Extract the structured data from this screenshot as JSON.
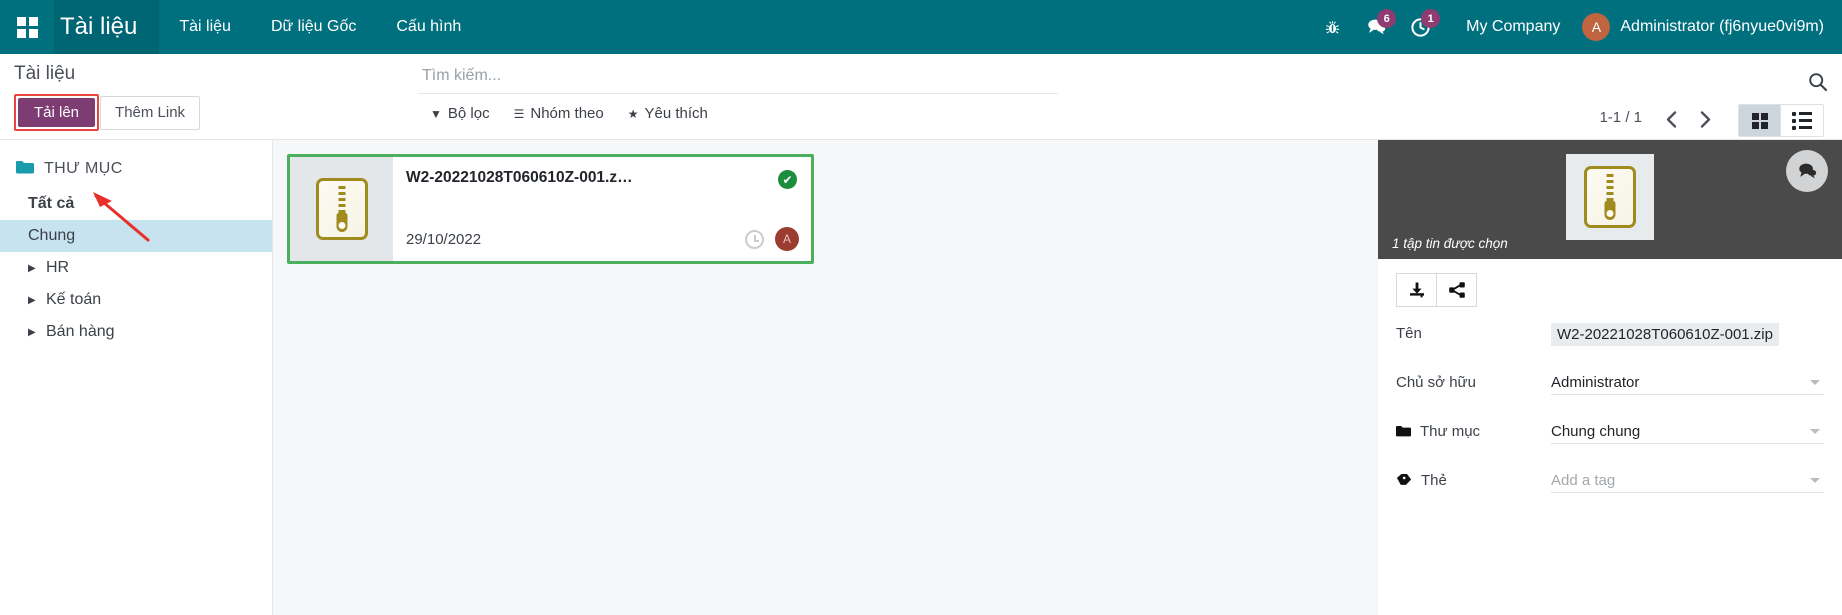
{
  "navbar": {
    "brand": "Tài liệu",
    "apps_icon": "apps-grid-icon",
    "menu": [
      {
        "label": "Tài liệu"
      },
      {
        "label": "Dữ liệu Gốc"
      },
      {
        "label": "Cấu hình"
      }
    ],
    "bug_icon": "bug-icon",
    "messages_icon": "chat-icon",
    "messages_count": "6",
    "activities_icon": "clock-activity-icon",
    "activities_count": "1",
    "company": "My Company",
    "user_initial": "A",
    "user": "Administrator (fj6nyue0vi9m)",
    "accent": "#00707f",
    "badge_color": "#8f3c72"
  },
  "control_panel": {
    "title": "Tài liệu",
    "upload_button": "Tải lên",
    "add_link_button": "Thêm Link",
    "upload_highlight_color": "#e8453c",
    "upload_button_color": "#7d3c72"
  },
  "search": {
    "placeholder": "Tìm kiếm...",
    "search_icon": "search-icon",
    "filters": [
      {
        "label": "Bộ lọc",
        "icon": "filter-icon"
      },
      {
        "label": "Nhóm theo",
        "icon": "group-by-icon"
      },
      {
        "label": "Yêu thích",
        "icon": "star-icon"
      }
    ]
  },
  "pager": {
    "range": "1-1 / 1",
    "prev_icon": "chevron-left-icon",
    "next_icon": "chevron-right-icon"
  },
  "view_switcher": {
    "kanban_icon": "kanban-view-icon",
    "list_icon": "list-view-icon",
    "active": "kanban"
  },
  "sidebar": {
    "header": "THƯ MỤC",
    "header_icon": "folder-icon",
    "items": [
      {
        "label": "Tất cả",
        "expandable": false,
        "selected": false,
        "bold": true
      },
      {
        "label": "Chung",
        "expandable": false,
        "selected": true,
        "bold": false
      },
      {
        "label": "HR",
        "expandable": true,
        "selected": false,
        "bold": false
      },
      {
        "label": "Kế toán",
        "expandable": true,
        "selected": false,
        "bold": false
      },
      {
        "label": "Bán hàng",
        "expandable": true,
        "selected": false,
        "bold": false
      }
    ]
  },
  "kanban": {
    "cards": [
      {
        "title": "W2-20221028T060610Z-001.z…",
        "date": "29/10/2022",
        "file_icon": "zip-file-icon",
        "selected_icon": "check-circle-icon",
        "clock_icon": "clock-icon",
        "avatar_initial": "A",
        "selected_border_color": "#4caf5d"
      }
    ]
  },
  "inspector": {
    "preview_icon": "zip-file-icon",
    "chat_icon": "chat-bubble-icon",
    "selection_text": "1 tập tin được chọn",
    "actions": [
      {
        "icon": "download-icon",
        "name": "download-button"
      },
      {
        "icon": "share-icon",
        "name": "share-button"
      }
    ],
    "fields": [
      {
        "label": "Tên",
        "value": "W2-20221028T060610Z-001.zip",
        "style": "highlight",
        "icon": null,
        "dropdown": false,
        "placeholder": null
      },
      {
        "label": "Chủ sở hữu",
        "value": "Administrator",
        "style": "underline",
        "icon": null,
        "dropdown": true,
        "placeholder": null
      },
      {
        "label": "Thư mục",
        "value": "Chung chung",
        "style": "underline",
        "icon": "folder-icon",
        "dropdown": true,
        "placeholder": null
      },
      {
        "label": "Thẻ",
        "value": "",
        "style": "underline",
        "icon": "tag-icon",
        "dropdown": true,
        "placeholder": "Add a tag"
      }
    ]
  }
}
